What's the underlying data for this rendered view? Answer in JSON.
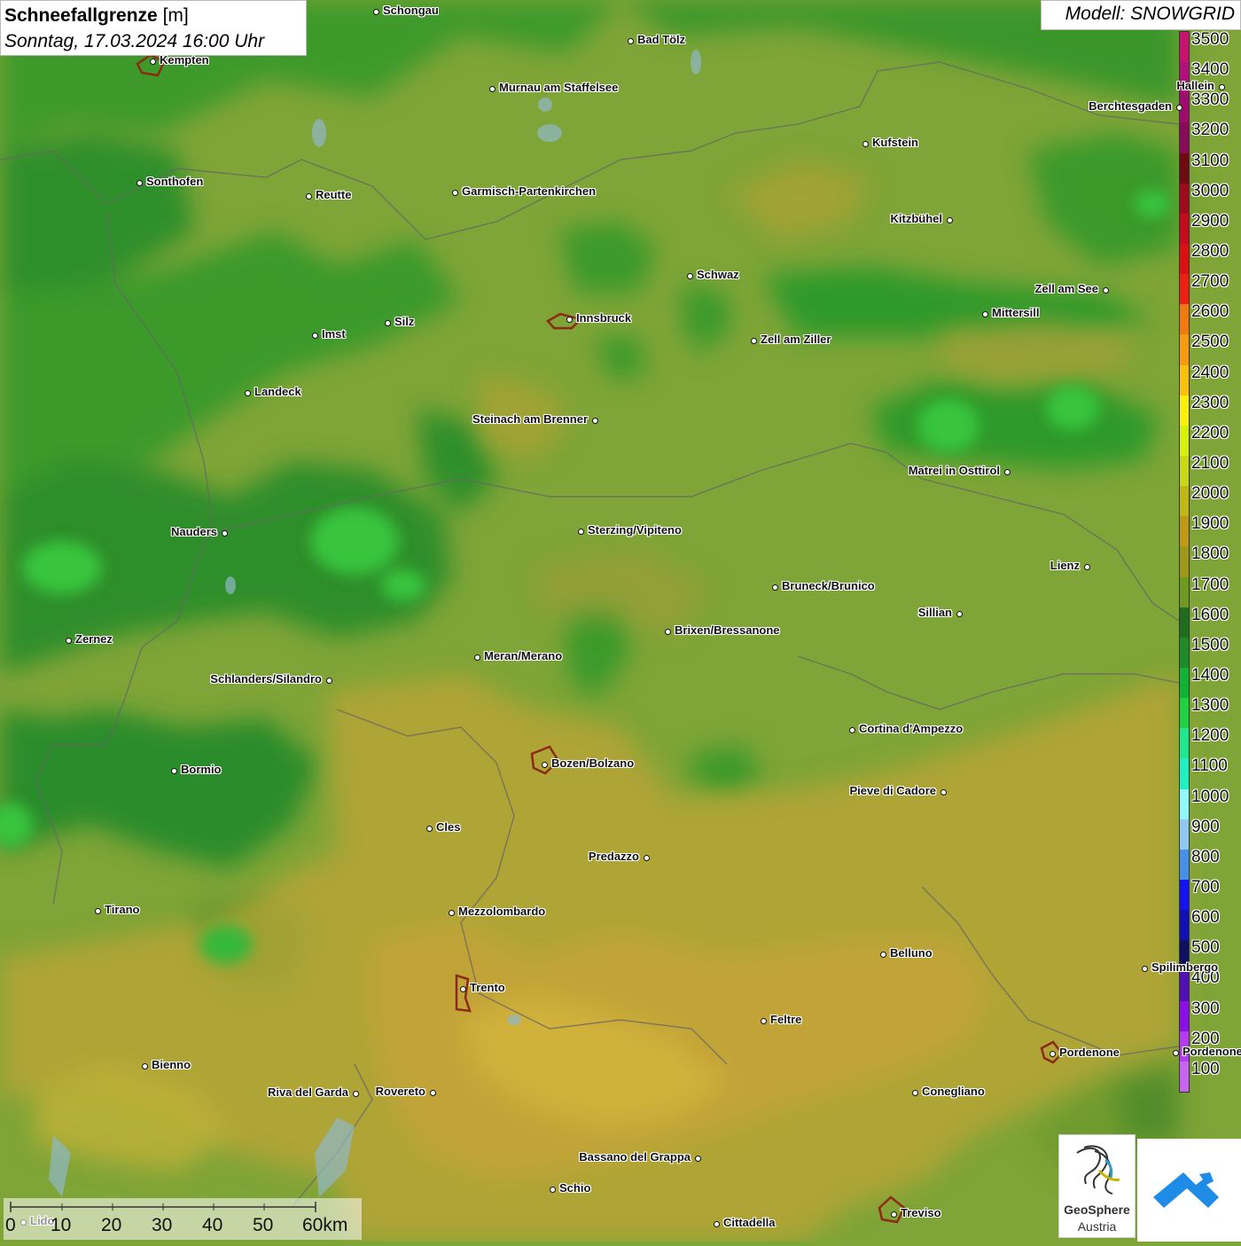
{
  "title": {
    "main": "Schneefallgrenze",
    "unit": "[m]",
    "datetime": "Sonntag, 17.03.2024 16:00 Uhr"
  },
  "model": "Modell: SNOWGRID",
  "legend": {
    "labels": [
      "3500",
      "3400",
      "3300",
      "3200",
      "3100",
      "3000",
      "2900",
      "2800",
      "2700",
      "2600",
      "2500",
      "2400",
      "2300",
      "2200",
      "2100",
      "2000",
      "1900",
      "1800",
      "1700",
      "1600",
      "1500",
      "1400",
      "1300",
      "1200",
      "1100",
      "1000",
      "900",
      "800",
      "700",
      "600",
      "500",
      "400",
      "300",
      "200",
      "100"
    ],
    "colors": [
      "#c8126e",
      "#b4107a",
      "#a00c6e",
      "#8a0a5a",
      "#6e0a10",
      "#a00a1a",
      "#c80a1e",
      "#dc1010",
      "#f02010",
      "#f07a10",
      "#f89a10",
      "#fac010",
      "#f8f010",
      "#d8f010",
      "#c8d818",
      "#c0b818",
      "#c09818",
      "#a09818",
      "#6e9a1e",
      "#1e6e1e",
      "#1e8c28",
      "#10b432",
      "#20d240",
      "#20e88c",
      "#20f0c0",
      "#90f8f8",
      "#90c8f0",
      "#4690e8",
      "#1414f0",
      "#1010b4",
      "#101060",
      "#5010b4",
      "#8a10e6",
      "#b43cf0",
      "#c864f0"
    ]
  },
  "cities": [
    {
      "name": "Schongau"
    },
    {
      "name": "Bad Tölz"
    },
    {
      "name": "Kempten"
    },
    {
      "name": "Murnau am Staffelsee"
    },
    {
      "name": "Berchtesgaden"
    },
    {
      "name": "Hallein"
    },
    {
      "name": "Kufstein"
    },
    {
      "name": "Sonthofen"
    },
    {
      "name": "Reutte"
    },
    {
      "name": "Garmisch-Partenkirchen"
    },
    {
      "name": "Kitzbühel"
    },
    {
      "name": "Schwaz"
    },
    {
      "name": "Zell am See"
    },
    {
      "name": "Mittersill"
    },
    {
      "name": "Innsbruck"
    },
    {
      "name": "Silz"
    },
    {
      "name": "Imst"
    },
    {
      "name": "Zell am Ziller"
    },
    {
      "name": "Landeck"
    },
    {
      "name": "Steinach am Brenner"
    },
    {
      "name": "Matrei in Osttirol"
    },
    {
      "name": "Nauders"
    },
    {
      "name": "Sterzing/Vipiteno"
    },
    {
      "name": "Lienz"
    },
    {
      "name": "Bruneck/Brunico"
    },
    {
      "name": "Sillian"
    },
    {
      "name": "Zernez"
    },
    {
      "name": "Brixen/Bressanone"
    },
    {
      "name": "Meran/Merano"
    },
    {
      "name": "Schlanders/Silandro"
    },
    {
      "name": "Cortina d'Ampezzo"
    },
    {
      "name": "Bozen/Bolzano"
    },
    {
      "name": "Bormio"
    },
    {
      "name": "Pieve di Cadore"
    },
    {
      "name": "Cles"
    },
    {
      "name": "Predazzo"
    },
    {
      "name": "Tirano"
    },
    {
      "name": "Mezzolombardo"
    },
    {
      "name": "Belluno"
    },
    {
      "name": "Spilimbergo"
    },
    {
      "name": "Trento"
    },
    {
      "name": "Feltre"
    },
    {
      "name": "Pordenone"
    },
    {
      "name": "Bienno"
    },
    {
      "name": "Riva del Garda"
    },
    {
      "name": "Rovereto"
    },
    {
      "name": "Conegliano"
    },
    {
      "name": "Bassano del Grappa"
    },
    {
      "name": "Schio"
    },
    {
      "name": "Treviso"
    },
    {
      "name": "Cittadella"
    },
    {
      "name": "Lido"
    },
    {
      "name": "Pordenone"
    }
  ],
  "scale": {
    "labels": [
      "0",
      "10",
      "20",
      "30",
      "40",
      "50",
      "60km"
    ]
  },
  "logos": {
    "geosphere_line1": "GeoSphere",
    "geosphere_line2": "Austria"
  }
}
